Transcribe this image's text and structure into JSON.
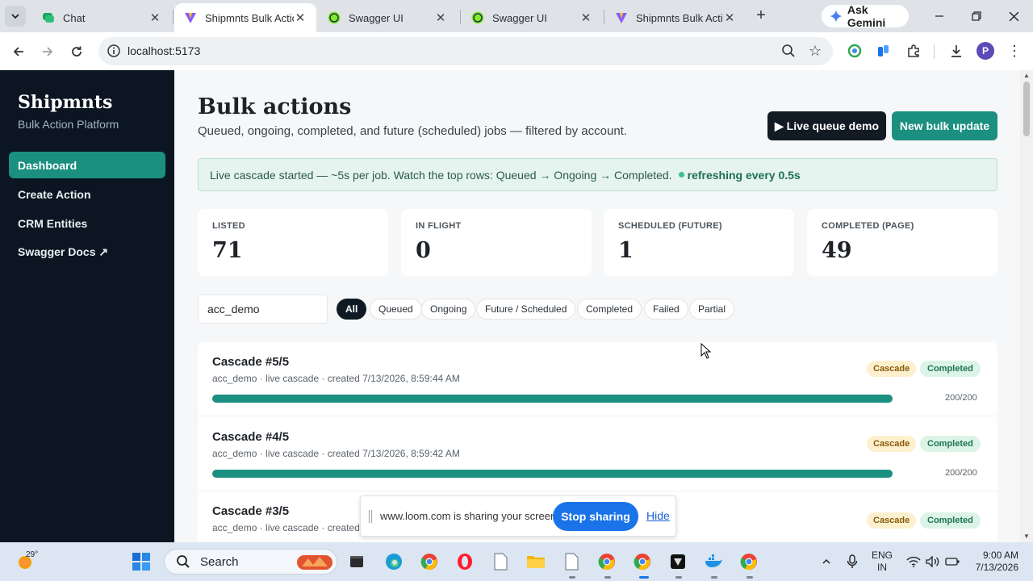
{
  "browser": {
    "tabs": [
      {
        "title": "Chat",
        "favicon": "chat-favicon"
      },
      {
        "title": "Shipmnts Bulk Actio",
        "favicon": "vite-favicon"
      },
      {
        "title": "Swagger UI",
        "favicon": "swagger-favicon"
      },
      {
        "title": "Swagger UI",
        "favicon": "swagger-favicon"
      },
      {
        "title": "Shipmnts Bulk Actio",
        "favicon": "vite-favicon"
      }
    ],
    "active_tab": 1,
    "ask_gemini": "Ask Gemini",
    "url": "localhost:5173",
    "profile_initial": "P"
  },
  "sidebar": {
    "brand": "Shipmnts",
    "subtitle": "Bulk Action Platform",
    "items": [
      {
        "label": "Dashboard",
        "active": true
      },
      {
        "label": "Create Action",
        "active": false
      },
      {
        "label": "CRM Entities",
        "active": false
      },
      {
        "label": "Swagger Docs ↗",
        "active": false
      }
    ]
  },
  "header": {
    "title": "Bulk actions",
    "subtitle": "Queued, ongoing, completed, and future (scheduled) jobs — filtered by account.",
    "live_button": "▶ Live queue demo",
    "new_button": "New bulk update"
  },
  "banner": {
    "text": "Live cascade started — ~5s per job. Watch the top rows: Queued → Ongoing → Completed.",
    "refresh": "refreshing every 0.5s"
  },
  "stats": [
    {
      "label": "LISTED",
      "value": "71"
    },
    {
      "label": "IN FLIGHT",
      "value": "0"
    },
    {
      "label": "SCHEDULED (FUTURE)",
      "value": "1"
    },
    {
      "label": "COMPLETED (PAGE)",
      "value": "49"
    }
  ],
  "filters": {
    "account": "acc_demo",
    "chips": [
      "All",
      "Queued",
      "Ongoing",
      "Future / Scheduled",
      "Completed",
      "Failed",
      "Partial"
    ],
    "active": "All"
  },
  "jobs": [
    {
      "title": "Cascade #5/5",
      "meta": "acc_demo · live cascade · created 7/13/2026, 8:59:44 AM",
      "type": "Cascade",
      "status": "Completed",
      "progress": "200/200",
      "fraction": 1.0
    },
    {
      "title": "Cascade #4/5",
      "meta": "acc_demo · live cascade · created 7/13/2026, 8:59:42 AM",
      "type": "Cascade",
      "status": "Completed",
      "progress": "200/200",
      "fraction": 1.0
    },
    {
      "title": "Cascade #3/5",
      "meta": "acc_demo · live cascade · created 7/",
      "type": "Cascade",
      "status": "Completed",
      "progress": "",
      "fraction": 1.0
    }
  ],
  "loom": {
    "message": "www.loom.com is sharing your screen.",
    "stop": "Stop sharing",
    "hide": "Hide"
  },
  "taskbar": {
    "temperature": "29°",
    "search": "Search",
    "lang_top": "ENG",
    "lang_bottom": "IN",
    "time": "9:00 AM",
    "date": "7/13/2026"
  },
  "colors": {
    "accent": "#1b8f80",
    "sidebar_bg": "#0b1622",
    "dark_button": "#121a24",
    "loom_blue": "#1a73e8"
  }
}
